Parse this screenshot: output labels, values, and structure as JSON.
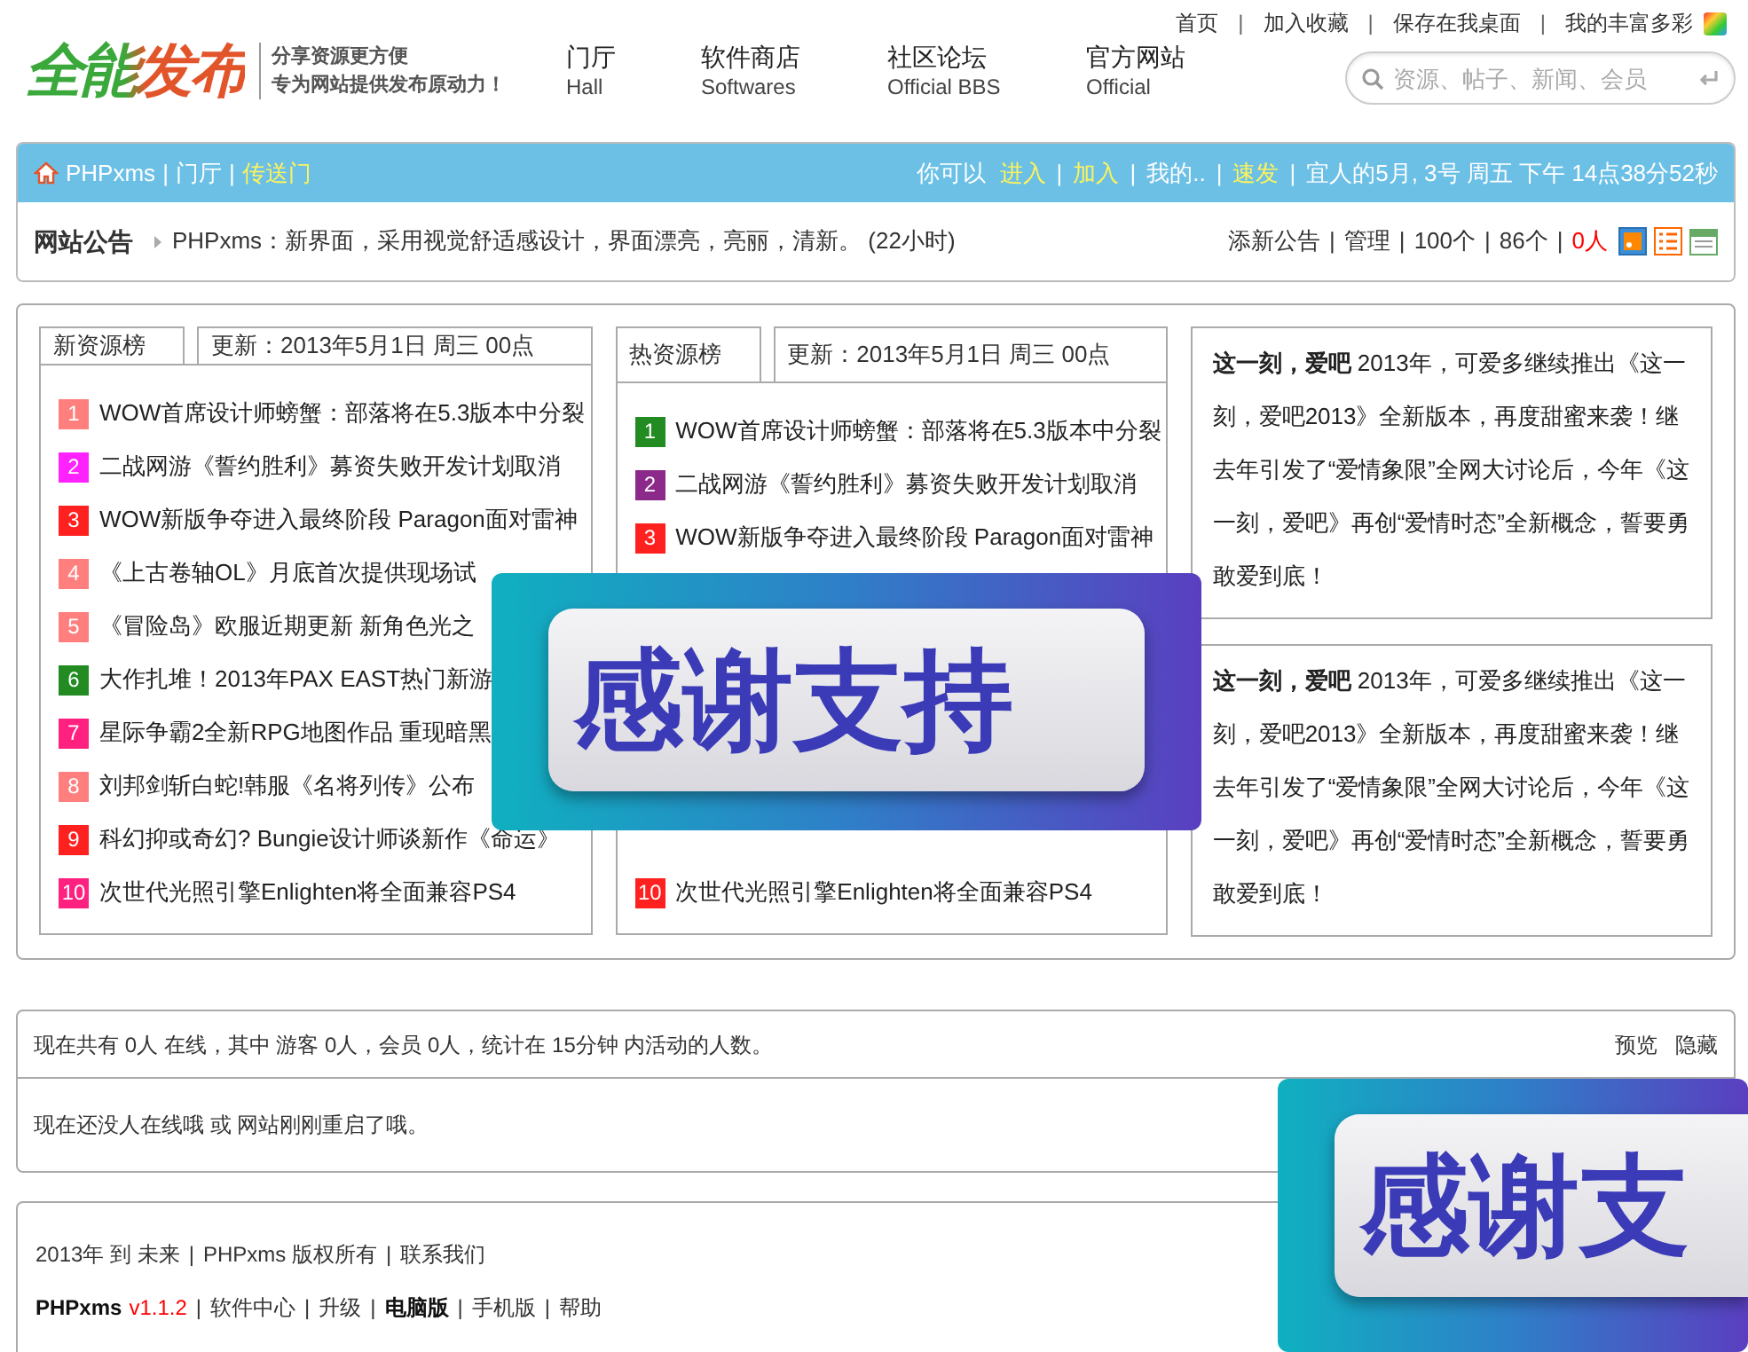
{
  "separator": "|",
  "top_links": [
    "首页",
    "加入收藏",
    "保存在我桌面",
    "我的丰富多彩"
  ],
  "logo": {
    "title": "全能发布",
    "tagline_1": "分享资源更方便",
    "tagline_2": "专为网站提供发布原动力！"
  },
  "nav": [
    {
      "label": "门厅",
      "sublabel": "Hall"
    },
    {
      "label": "软件商店",
      "sublabel": "Softwares"
    },
    {
      "label": "社区论坛",
      "sublabel": "Official BBS"
    },
    {
      "label": "官方网站",
      "sublabel": "Official"
    }
  ],
  "search": {
    "placeholder": "资源、帖子、新闻、会员"
  },
  "info_bar": {
    "left": [
      {
        "text": "PHPxms",
        "highlight": false
      },
      {
        "text": "门厅",
        "highlight": false
      },
      {
        "text": "传送门",
        "highlight": true
      }
    ],
    "prompt": "你可以",
    "right": [
      {
        "text": "进入",
        "highlight": true
      },
      {
        "text": "加入",
        "highlight": true
      },
      {
        "text": "我的..",
        "highlight": false
      },
      {
        "text": "速发",
        "highlight": true
      },
      {
        "text": "宜人的5月, 3号 周五 下午 14点38分52秒",
        "highlight": false
      }
    ]
  },
  "notice": {
    "label": "网站公告",
    "text": "PHPxms：新界面，采用视觉舒适感设计，界面漂亮，亮丽，清新。 (22小时)",
    "actions": [
      {
        "text": "添新公告",
        "alert": false
      },
      {
        "text": "管理",
        "alert": false
      },
      {
        "text": "100个",
        "alert": false
      },
      {
        "text": "86个",
        "alert": false
      },
      {
        "text": "0人",
        "alert": true
      }
    ]
  },
  "lists": [
    {
      "tab": "新资源榜",
      "updated": "更新：2013年5月1日 周三 00点",
      "items": [
        {
          "rank": "1",
          "text": "WOW首席设计师螃蟹：部落将在5.3版本中分裂",
          "color": "#ff7f7f"
        },
        {
          "rank": "2",
          "text": "二战网游《誓约胜利》募资失败开发计划取消",
          "color": "#ff22ff"
        },
        {
          "rank": "3",
          "text": "WOW新版争夺进入最终阶段 Paragon面对雷神",
          "color": "#ff2020"
        },
        {
          "rank": "4",
          "text": "《上古卷轴OL》月底首次提供现场试",
          "color": "#ff7f7f"
        },
        {
          "rank": "5",
          "text": "《冒险岛》欧服近期更新 新角色光之",
          "color": "#ff7f7f"
        },
        {
          "rank": "6",
          "text": "大作扎堆！2013年PAX EAST热门新游",
          "color": "#228b22"
        },
        {
          "rank": "7",
          "text": "星际争霸2全新RPG地图作品 重现暗黑",
          "color": "#ff2080"
        },
        {
          "rank": "8",
          "text": "刘邦剑斩白蛇!韩服《名将列传》公布",
          "color": "#ff7f7f"
        },
        {
          "rank": "9",
          "text": "科幻抑或奇幻? Bungie设计师谈新作《命运》",
          "color": "#ff2020"
        },
        {
          "rank": "10",
          "text": "次世代光照引擎Enlighten将全面兼容PS4",
          "color": "#ff2080"
        }
      ]
    },
    {
      "tab": "热资源榜",
      "updated": "更新：2013年5月1日 周三 00点",
      "items": [
        {
          "rank": "1",
          "text": "WOW首席设计师螃蟹：部落将在5.3版本中分裂",
          "color": "#228b22"
        },
        {
          "rank": "2",
          "text": "二战网游《誓约胜利》募资失败开发计划取消",
          "color": "#8b2a8b"
        },
        {
          "rank": "3",
          "text": "WOW新版争夺进入最终阶段 Paragon面对雷神",
          "color": "#ff2020"
        }
      ],
      "items_below": [
        {
          "rank": "10",
          "text": "次世代光照引擎Enlighten将全面兼容PS4",
          "color": "#ff2020"
        }
      ]
    }
  ],
  "articles": [
    {
      "text": "**这一刻，爱吧** 2013年，可爱多继续推出《这一刻，爱吧2013》全新版本，再度甜蜜来袭！继去年引发了“爱情象限”全网大讨论后，今年《这一刻，爱吧》再创“爱情时态”全新概念，誓要勇敢爱到底！"
    },
    {
      "text": "**这一刻，爱吧** 2013年，可爱多继续推出《这一刻，爱吧2013》全新版本，再度甜蜜来袭！继去年引发了“爱情象限”全网大讨论后，今年《这一刻，爱吧》再创“爱情时态”全新概念，誓要勇敢爱到底！"
    }
  ],
  "online": {
    "summary": "现在共有 0人 在线，其中 游客 0人，会员 0人，统计在 15分钟 内活动的人数。",
    "actions": [
      "预览",
      "隐藏"
    ],
    "message": "现在还没人在线哦 或 网站刚刚重启了哦。"
  },
  "footer": {
    "line_1": [
      "2013年 到 未来",
      "PHPxms 版权所有",
      "联系我们"
    ],
    "product": {
      "name": "PHPxms",
      "version": "v1.1.2"
    },
    "links": [
      {
        "text": "软件中心",
        "current": false
      },
      {
        "text": "升级",
        "current": false
      },
      {
        "text": "电脑版",
        "current": true
      },
      {
        "text": "手机版",
        "current": false
      },
      {
        "text": "帮助",
        "current": false
      }
    ]
  },
  "overlays": [
    {
      "text": "感谢支持"
    },
    {
      "text": "感谢支"
    }
  ]
}
